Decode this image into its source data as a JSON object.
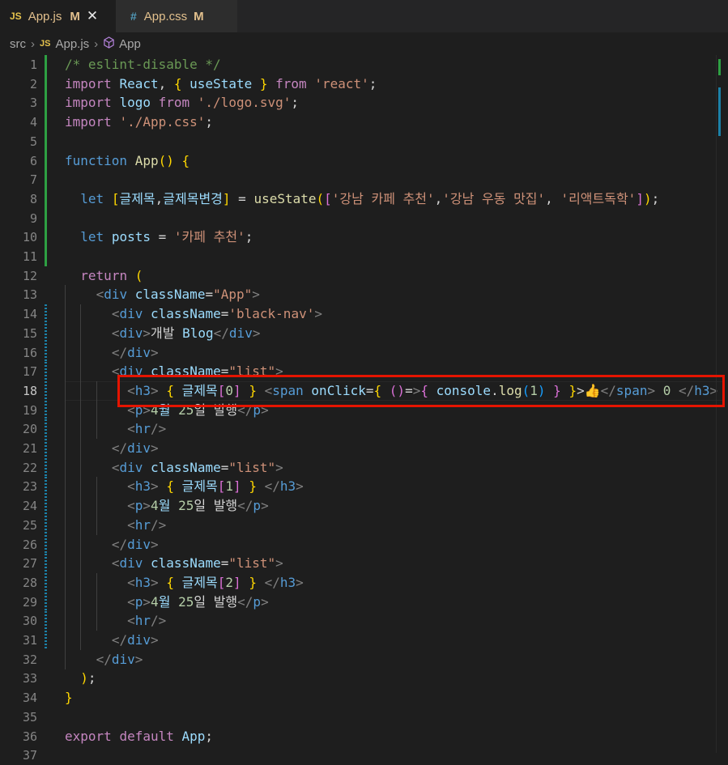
{
  "tabs": [
    {
      "icon": "JS",
      "name": "App.js",
      "status": "M",
      "active": true
    },
    {
      "icon": "#",
      "name": "App.css",
      "status": "M",
      "active": false
    }
  ],
  "breadcrumb": [
    "src",
    "App.js",
    "App"
  ],
  "editor": {
    "current_line": 18,
    "lines": [
      {
        "n": "1",
        "text": "/* eslint-disable */"
      },
      {
        "n": "2",
        "text": "import React, { useState } from 'react';"
      },
      {
        "n": "3",
        "text": "import logo from './logo.svg';"
      },
      {
        "n": "4",
        "text": "import './App.css';"
      },
      {
        "n": "5",
        "text": ""
      },
      {
        "n": "6",
        "text": "function App() {"
      },
      {
        "n": "7",
        "text": ""
      },
      {
        "n": "8",
        "text": "  let [글제목,글제목변경] = useState(['강남 카페 추천','강남 우동 맛집', '리액트독학']);"
      },
      {
        "n": "9",
        "text": ""
      },
      {
        "n": "10",
        "text": "  let posts = '카페 추천';"
      },
      {
        "n": "11",
        "text": ""
      },
      {
        "n": "12",
        "text": "  return ("
      },
      {
        "n": "13",
        "text": "    <div className=\"App\">"
      },
      {
        "n": "14",
        "text": "      <div className='black-nav'>"
      },
      {
        "n": "15",
        "text": "      <div>개발 Blog</div>"
      },
      {
        "n": "16",
        "text": "      </div>"
      },
      {
        "n": "17",
        "text": "      <div className=\"list\">"
      },
      {
        "n": "18",
        "text": "        <h3> { 글제목[0] } <span onClick={ ()=>{ console.log(1) } }>👍</span> 0 </h3>"
      },
      {
        "n": "19",
        "text": "        <p>4월 25일 발행</p>"
      },
      {
        "n": "20",
        "text": "        <hr/>"
      },
      {
        "n": "21",
        "text": "      </div>"
      },
      {
        "n": "22",
        "text": "      <div className=\"list\">"
      },
      {
        "n": "23",
        "text": "        <h3> { 글제목[1] } </h3>"
      },
      {
        "n": "24",
        "text": "        <p>4월 25일 발행</p>"
      },
      {
        "n": "25",
        "text": "        <hr/>"
      },
      {
        "n": "26",
        "text": "      </div>"
      },
      {
        "n": "27",
        "text": "      <div className=\"list\">"
      },
      {
        "n": "28",
        "text": "        <h3> { 글제목[2] } </h3>"
      },
      {
        "n": "29",
        "text": "        <p>4월 25일 발행</p>"
      },
      {
        "n": "30",
        "text": "        <hr/>"
      },
      {
        "n": "31",
        "text": "      </div>"
      },
      {
        "n": "32",
        "text": "    </div>"
      },
      {
        "n": "33",
        "text": "  );"
      },
      {
        "n": "34",
        "text": "}"
      },
      {
        "n": "35",
        "text": ""
      },
      {
        "n": "36",
        "text": "export default App;"
      },
      {
        "n": "37",
        "text": ""
      }
    ]
  },
  "colors": {
    "background": "#1e1e1e",
    "highlight_border": "#e51400",
    "modified_gutter": "#2ea043",
    "added_gutter": "#1b81a8"
  }
}
